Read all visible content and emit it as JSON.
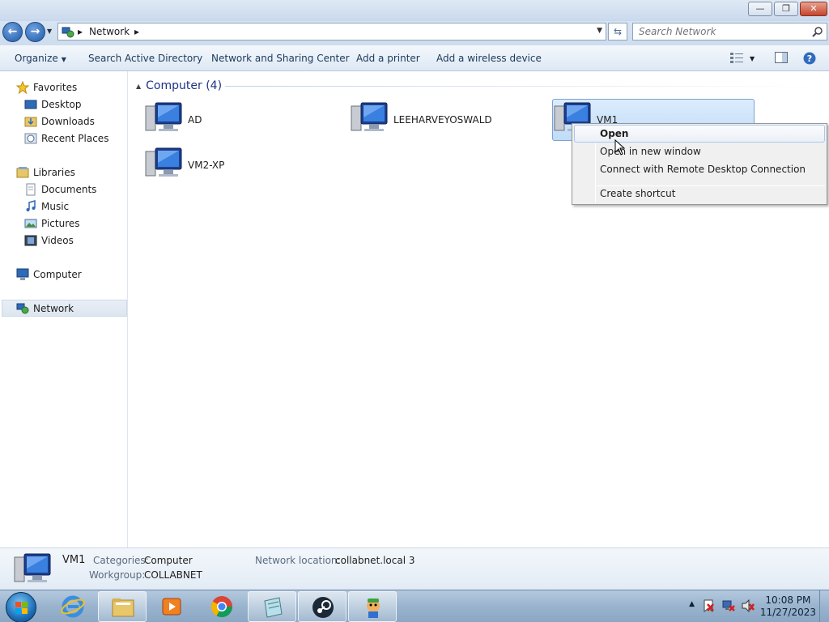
{
  "window": {
    "buttons": {
      "minimize": "—",
      "maximize": "❐",
      "close": "✕"
    }
  },
  "address": {
    "crumb": "Network",
    "search_placeholder": "Search Network"
  },
  "commands": {
    "organize": "Organize",
    "search_ad": "Search Active Directory",
    "sharing_center": "Network and Sharing Center",
    "add_printer": "Add a printer",
    "add_wireless": "Add a wireless device"
  },
  "nav": {
    "favorites": "Favorites",
    "desktop": "Desktop",
    "downloads": "Downloads",
    "recent_places": "Recent Places",
    "libraries": "Libraries",
    "documents": "Documents",
    "music": "Music",
    "pictures": "Pictures",
    "videos": "Videos",
    "computer": "Computer",
    "network": "Network"
  },
  "content": {
    "group_header": "Computer (4)",
    "items": [
      {
        "name": "AD"
      },
      {
        "name": "LEEHARVEYOSWALD"
      },
      {
        "name": "VM1"
      },
      {
        "name": "VM2-XP"
      }
    ]
  },
  "context_menu": {
    "open": "Open",
    "open_new_window": "Open in new window",
    "connect_rdp": "Connect with Remote Desktop Connection",
    "create_shortcut": "Create shortcut"
  },
  "details": {
    "name": "VM1",
    "categories_label": "Categories:",
    "categories_value": "Computer",
    "workgroup_label": "Workgroup:",
    "workgroup_value": "COLLABNET",
    "network_location_label": "Network location:",
    "network_location_value": "collabnet.local  3"
  },
  "taskbar": {
    "time": "10:08 PM",
    "date": "11/27/2023"
  },
  "colors": {
    "accent": "#1e3287",
    "selection": "#c1dcf8"
  }
}
